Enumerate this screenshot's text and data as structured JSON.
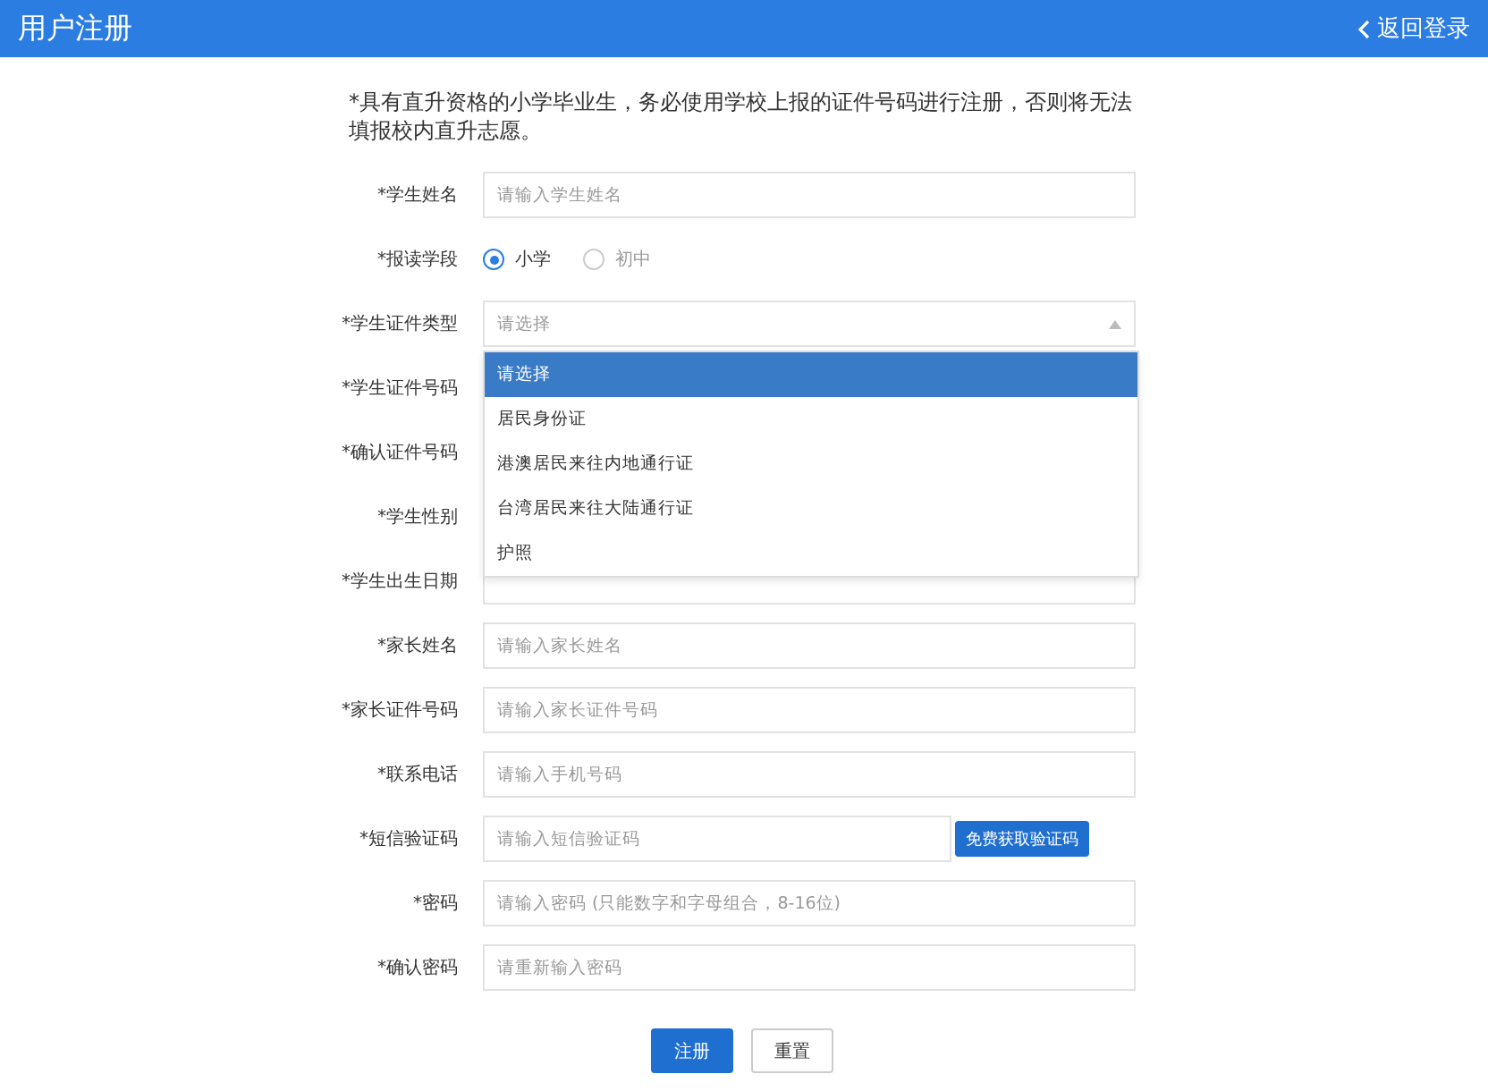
{
  "header": {
    "title": "用户注册",
    "back_link": "返回登录"
  },
  "notice": "*具有直升资格的小学毕业生，务必使用学校上报的证件号码进行注册，否则将无法填报校内直升志愿。",
  "fields": [
    {
      "kind": "input",
      "label": "*学生姓名",
      "placeholder": "请输入学生姓名"
    },
    {
      "kind": "radio",
      "label": "*报读学段",
      "options": [
        {
          "label": "小学",
          "selected": true
        },
        {
          "label": "初中",
          "selected": false
        }
      ]
    },
    {
      "kind": "select",
      "label": "*学生证件类型",
      "placeholder": "请选择",
      "expanded": true,
      "options": [
        {
          "label": "请选择",
          "selected": true
        },
        {
          "label": "居民身份证",
          "selected": false
        },
        {
          "label": "港澳居民来往内地通行证",
          "selected": false
        },
        {
          "label": "台湾居民来往大陆通行证",
          "selected": false
        },
        {
          "label": "护照",
          "selected": false
        }
      ]
    },
    {
      "kind": "covered",
      "label": "*学生证件号码"
    },
    {
      "kind": "covered",
      "label": "*确认证件号码"
    },
    {
      "kind": "covered",
      "label": "*学生性别"
    },
    {
      "kind": "input",
      "label": "*学生出生日期"
    },
    {
      "kind": "input",
      "label": "*家长姓名",
      "placeholder": "请输入家长姓名"
    },
    {
      "kind": "input",
      "label": "*家长证件号码",
      "placeholder": "请输入家长证件号码"
    },
    {
      "kind": "input",
      "label": "*联系电话",
      "placeholder": "请输入手机号码"
    },
    {
      "kind": "sms",
      "label": "*短信验证码",
      "placeholder": "请输入短信验证码",
      "button": "免费获取验证码"
    },
    {
      "kind": "input",
      "label": "*密码",
      "placeholder": "请输入密码 (只能数字和字母组合，8-16位)"
    },
    {
      "kind": "input",
      "label": "*确认密码",
      "placeholder": "请重新输入密码"
    }
  ],
  "buttons": {
    "submit": "注册",
    "reset": "重置"
  }
}
